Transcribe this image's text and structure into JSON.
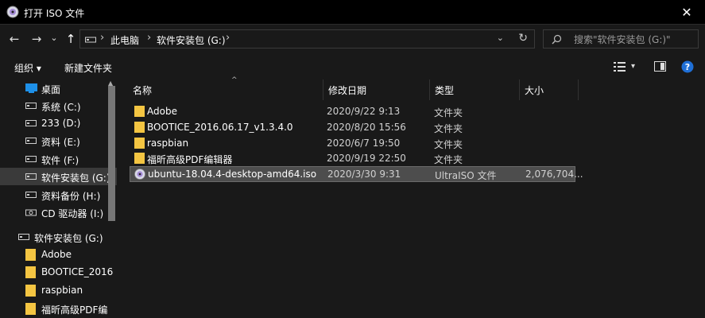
{
  "window": {
    "title": "打开 ISO 文件",
    "close_glyph": "✕"
  },
  "nav": {
    "back_glyph": "←",
    "forward_glyph": "→",
    "recent_glyph": "⌄",
    "up_glyph": "↑",
    "path": [
      "此电脑",
      "软件安装包 (G:)"
    ],
    "separator": "›",
    "dropdown_glyph": "⌄",
    "refresh_glyph": "↻"
  },
  "search": {
    "placeholder": "搜索\"软件安装包 (G:)\""
  },
  "toolbar": {
    "organize": "组织 ▾",
    "new_folder": "新建文件夹",
    "view_dropdown": "▾"
  },
  "sidebar": {
    "items": [
      {
        "label": "桌面",
        "icon": "desktop-icon"
      },
      {
        "label": "系统 (C:)",
        "icon": "drive-icon"
      },
      {
        "label": "233 (D:)",
        "icon": "drive-icon"
      },
      {
        "label": "资料 (E:)",
        "icon": "drive-icon"
      },
      {
        "label": "软件 (F:)",
        "icon": "drive-icon"
      },
      {
        "label": "软件安装包 (G:)",
        "icon": "drive-icon",
        "selected": true
      },
      {
        "label": "资料备份 (H:)",
        "icon": "drive-icon"
      },
      {
        "label": "CD 驱动器 (I:)",
        "icon": "cd-drive-icon"
      },
      {
        "label": "软件安装包 (G:)",
        "icon": "drive-icon"
      },
      {
        "label": "Adobe",
        "icon": "folder-icon"
      },
      {
        "label": "BOOTICE_2016",
        "icon": "folder-icon"
      },
      {
        "label": "raspbian",
        "icon": "folder-icon"
      },
      {
        "label": "福昕高级PDF编",
        "icon": "folder-icon"
      }
    ]
  },
  "columns": {
    "name": "名称",
    "date": "修改日期",
    "type": "类型",
    "size": "大小"
  },
  "files": [
    {
      "name": "Adobe",
      "date": "2020/9/22 9:13",
      "type": "文件夹",
      "size": "",
      "icon": "folder-icon"
    },
    {
      "name": "BOOTICE_2016.06.17_v1.3.4.0",
      "date": "2020/8/20 15:56",
      "type": "文件夹",
      "size": "",
      "icon": "folder-icon"
    },
    {
      "name": "raspbian",
      "date": "2020/6/7 19:50",
      "type": "文件夹",
      "size": "",
      "icon": "folder-icon"
    },
    {
      "name": "福昕高级PDF编辑器",
      "date": "2020/9/19 22:50",
      "type": "文件夹",
      "size": "",
      "icon": "folder-icon"
    },
    {
      "name": "ubuntu-18.04.4-desktop-amd64.iso",
      "date": "2020/3/30 9:31",
      "type": "UltraISO 文件",
      "size": "2,076,704...",
      "icon": "iso-disc-icon",
      "selected": true
    }
  ],
  "colors": {
    "folder": "#f4c542",
    "accent_help": "#1f6fd6",
    "selection": "#4d4d4d"
  }
}
